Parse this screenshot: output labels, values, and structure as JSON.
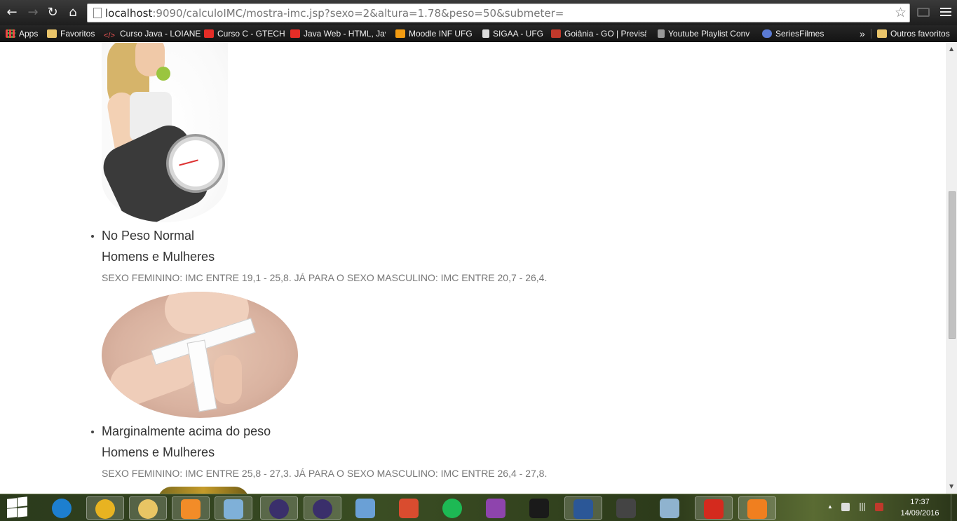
{
  "browser": {
    "url_host": "localhost",
    "url_rest": ":9090/calculoIMC/mostra-imc.jsp?sexo=2&altura=1.78&peso=50&submeter=",
    "bookmarks": [
      {
        "label": "Apps",
        "icon": "apps-grid-icon"
      },
      {
        "label": "Favoritos",
        "icon": "folder-icon"
      },
      {
        "label": "Curso Java - LOIANE",
        "icon": "code-icon"
      },
      {
        "label": "Curso C - GTECH",
        "icon": "youtube-icon"
      },
      {
        "label": "Java Web - HTML, Jav",
        "icon": "youtube-icon"
      },
      {
        "label": "Moodle INF UFG",
        "icon": "moodle-icon"
      },
      {
        "label": "SIGAA - UFG",
        "icon": "page-icon"
      },
      {
        "label": "Goiânia - GO | Previsã",
        "icon": "weather-icon"
      },
      {
        "label": "Youtube Playlist Conv",
        "icon": "music-note-icon"
      },
      {
        "label": "SeriesFilmes",
        "icon": "series-icon"
      }
    ],
    "overflow_label": "»",
    "other_bookmarks": "Outros favoritos"
  },
  "content": {
    "items": [
      {
        "title": "No Peso Normal",
        "subtitle": "Homens e Mulheres",
        "description": "SEXO FEMININO: IMC ENTRE 19,1 - 25,8. JÁ PARA O SEXO MASCULINO: IMC ENTRE 20,7 - 26,4."
      },
      {
        "title": "Marginalmente acima do peso",
        "subtitle": "Homens e Mulheres",
        "description": "SEXO FEMININO: IMC ENTRE 25,8 - 27,3. JÁ PARA O SEXO MASCULINO: IMC ENTRE 26,4 - 27,8."
      }
    ]
  },
  "taskbar": {
    "apps": [
      {
        "name": "internet-explorer-icon",
        "color": "#1d7fd0"
      },
      {
        "name": "chrome-icon",
        "color": "#e8b321"
      },
      {
        "name": "file-explorer-icon",
        "color": "#e8c564"
      },
      {
        "name": "media-player-icon",
        "color": "#f28c28"
      },
      {
        "name": "notepad-icon",
        "color": "#7fb0d8"
      },
      {
        "name": "eclipse-icon",
        "color": "#3a2f6b"
      },
      {
        "name": "eclipse-icon-2",
        "color": "#3a2f6b"
      },
      {
        "name": "virtualbox-icon",
        "color": "#6aa0d6"
      },
      {
        "name": "windows-store-icon",
        "color": "#d94c2f"
      },
      {
        "name": "spotify-icon",
        "color": "#1db954"
      },
      {
        "name": "android-studio-icon",
        "color": "#8e44ad"
      },
      {
        "name": "intellij-icon",
        "color": "#1a1a1a"
      },
      {
        "name": "word-icon",
        "color": "#2b5797"
      },
      {
        "name": "terminal-icon",
        "color": "#444444"
      },
      {
        "name": "calculator-icon",
        "color": "#8fb3cf"
      },
      {
        "name": "acrobat-icon",
        "color": "#d42a1e"
      },
      {
        "name": "foxit-pdf-icon",
        "color": "#f07f1f"
      }
    ],
    "time": "17:37",
    "date": "14/09/2016"
  }
}
